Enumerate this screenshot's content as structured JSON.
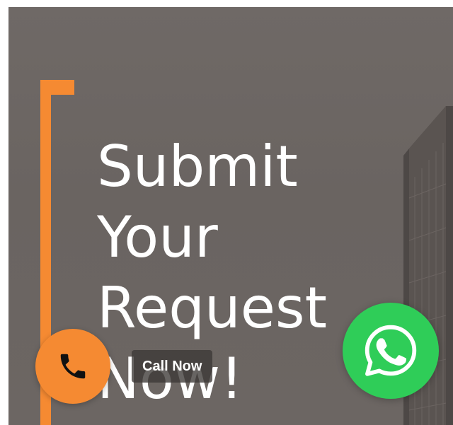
{
  "hero": {
    "headline_lines": [
      "Submit",
      "Your",
      "Request",
      "Now!"
    ]
  },
  "floating_actions": {
    "call_label": "Call Now",
    "call_icon": "phone-icon",
    "whatsapp_icon": "whatsapp-icon"
  },
  "colors": {
    "accent": "#f58a32",
    "whatsapp": "#2fcd58",
    "background": "#6d6764",
    "text": "#ffffff"
  }
}
